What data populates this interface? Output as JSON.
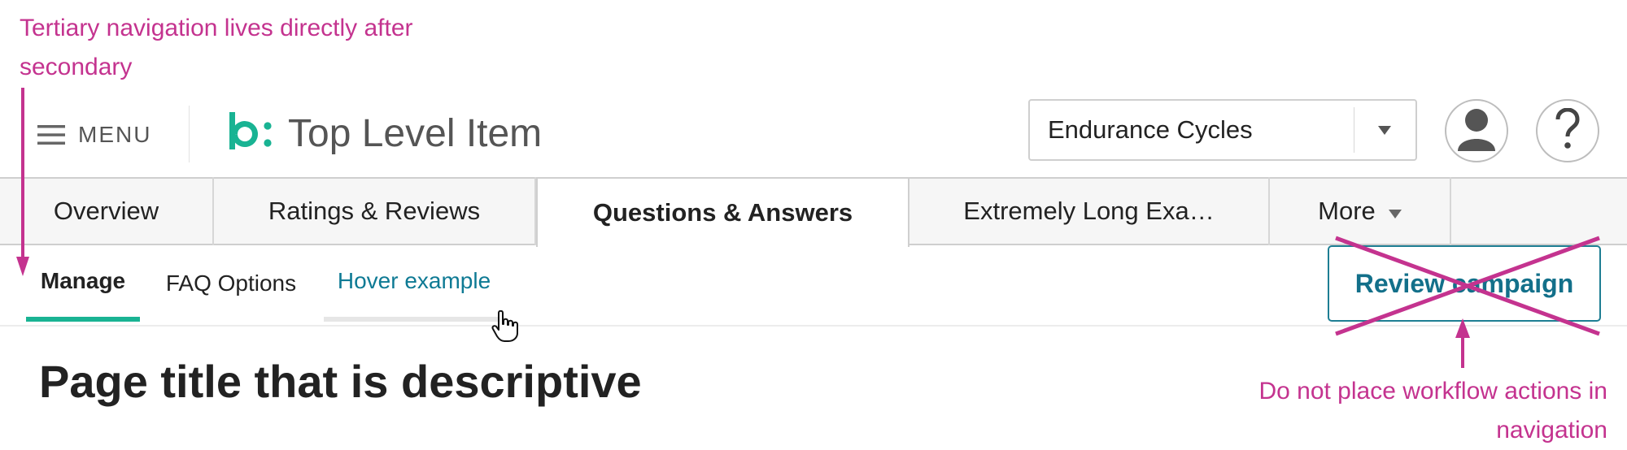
{
  "annotations": {
    "tertiary_note": "Tertiary navigation lives directly after secondary",
    "workflow_note": "Do not place workflow actions in navigation",
    "color": "#c4338f"
  },
  "header": {
    "menu_label": "MENU",
    "brand_mark": "b:",
    "title": "Top Level Item",
    "selector": {
      "value": "Endurance Cycles"
    },
    "icons": [
      "hamburger-icon",
      "bazaarvoice-logo",
      "chevron-down-icon",
      "user-icon",
      "help-icon"
    ]
  },
  "primary_nav": {
    "tabs": [
      {
        "label": "Overview"
      },
      {
        "label": "Ratings & Reviews"
      },
      {
        "label": "Questions & Answers",
        "active": true
      },
      {
        "label": "Extremely Long Exa…"
      },
      {
        "label": "More"
      }
    ]
  },
  "secondary_nav": {
    "tabs": [
      {
        "label": "Manage",
        "active": true
      },
      {
        "label": "FAQ Options"
      },
      {
        "label": "Hover example",
        "hover": true
      }
    ]
  },
  "workflow_button": {
    "label": "Review campaign",
    "crossed_out": true
  },
  "page": {
    "title": "Page title that is descriptive"
  },
  "colors": {
    "accent": "#19b393",
    "link": "#0e7a94",
    "annotation": "#c4338f"
  }
}
